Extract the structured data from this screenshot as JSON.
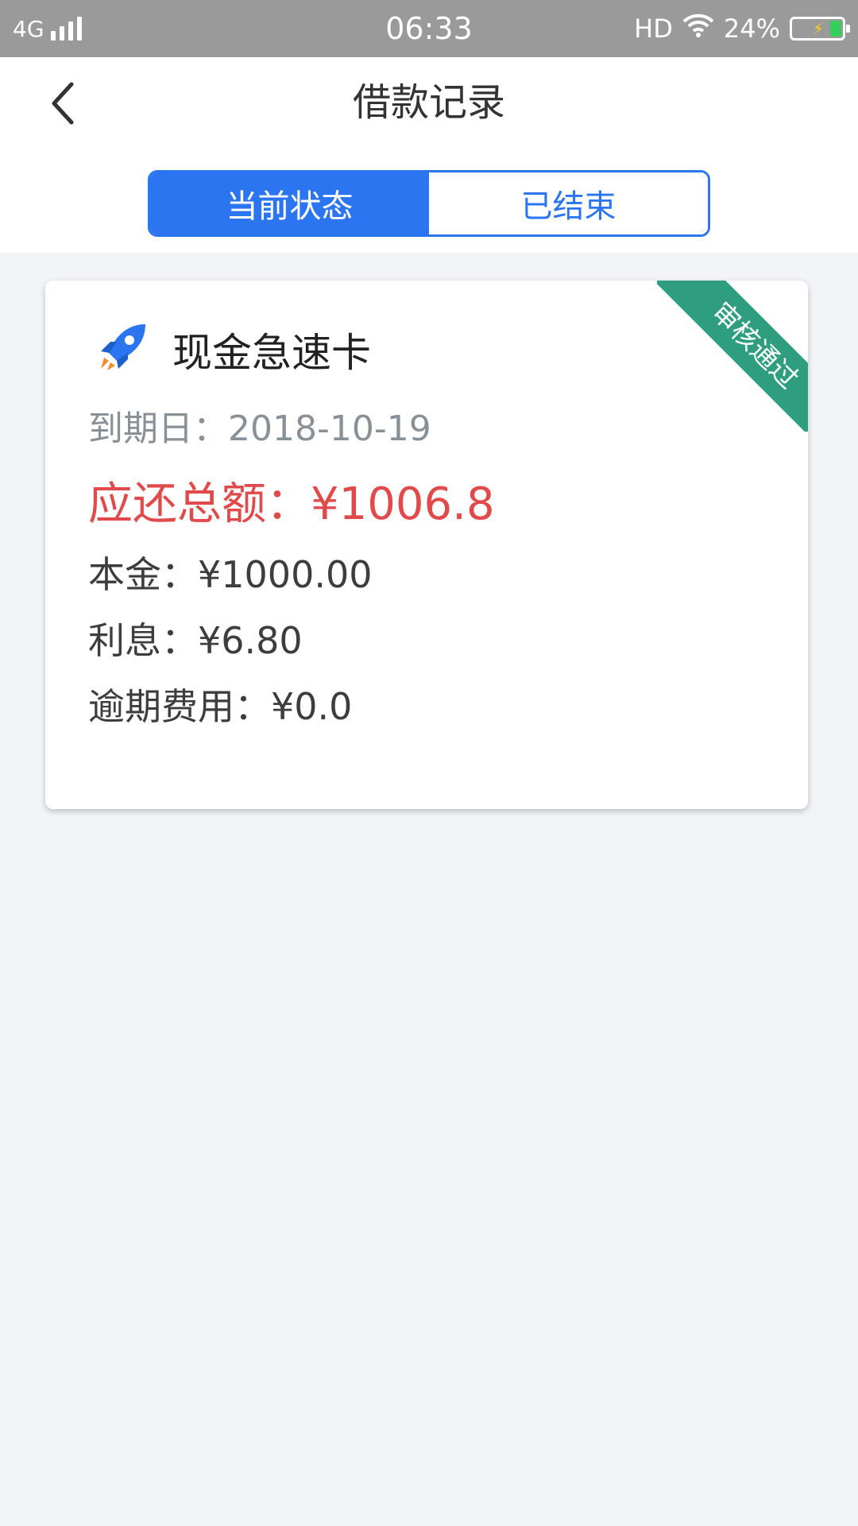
{
  "status_bar": {
    "network": "4G",
    "time": "06:33",
    "hd": "HD",
    "battery_percent": "24%",
    "battery_level": 0.24,
    "icons": [
      "signal-icon",
      "wifi-icon",
      "battery-icon"
    ]
  },
  "header": {
    "title": "借款记录",
    "back_icon": "chevron-left-icon"
  },
  "tabs": [
    {
      "label": "当前状态",
      "active": true
    },
    {
      "label": "已结束",
      "active": false
    }
  ],
  "loan_card": {
    "product_name": "现金急速卡",
    "product_icon": "rocket-icon",
    "status_ribbon": "审核通过",
    "due_date": "到期日：2018-10-19",
    "total_due": "应还总额：¥1006.8",
    "principal": "本金：¥1000.00",
    "interest": "利息：¥6.80",
    "overdue_fee": "逾期费用：¥0.0"
  },
  "colors": {
    "accent_blue": "#2b76f0",
    "amount_red": "#e04a4a",
    "ribbon_green": "#2f9e7f",
    "status_bar_gray": "#9a9a9a",
    "background": "#f2f4f8"
  }
}
